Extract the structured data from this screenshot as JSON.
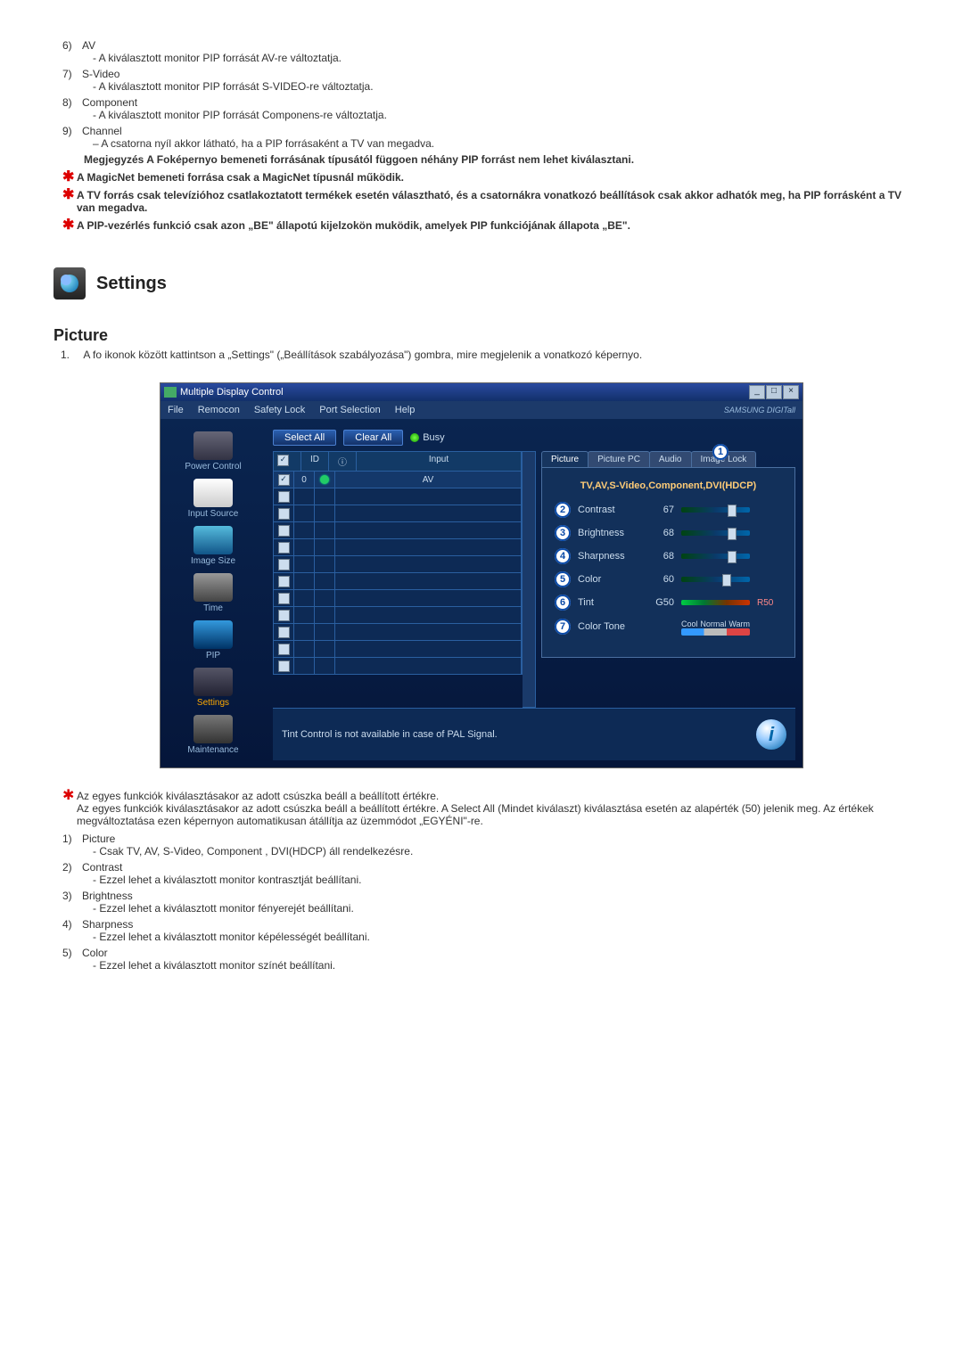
{
  "top_list": [
    {
      "num": "6)",
      "label": "AV",
      "desc": "- A kiválasztott monitor PIP forrását AV-re változtatja."
    },
    {
      "num": "7)",
      "label": "S-Video",
      "desc": "- A kiválasztott monitor PIP forrását S-VIDEO-re változtatja."
    },
    {
      "num": "8)",
      "label": "Component",
      "desc": "- A kiválasztott monitor PIP forrását Componens-re változtatja."
    },
    {
      "num": "9)",
      "label": "Channel",
      "desc": "– A csatorna nyíl akkor látható, ha a PIP forrásaként a TV van megadva."
    }
  ],
  "note_after9": "Megjegyzés A Foképernyo bemeneti forrásának típusától függoen néhány PIP forrást nem lehet kiválasztani.",
  "star_notes_top": [
    "A MagicNet bemeneti forrása csak a MagicNet típusnál működik.",
    "A TV forrás csak televízióhoz csatlakoztatott termékek esetén választható, és a csatornákra vonatkozó beállítások csak akkor adhatók meg, ha PIP forrásként a TV van megadva.",
    "A PIP-vezérlés funkció csak azon „BE\" állapotú kijelzokön muködik, amelyek PIP funkciójának állapota „BE\"."
  ],
  "settings_heading": "Settings",
  "picture_heading": "Picture",
  "picture_intro_num": "1.",
  "picture_intro": "A fo ikonok között kattintson a „Settings\" („Beállítások szabályozása\") gombra, mire megjelenik a vonatkozó képernyo.",
  "window": {
    "title": "Multiple Display Control",
    "menu": [
      "File",
      "Remocon",
      "Safety Lock",
      "Port Selection",
      "Help"
    ],
    "brand": "SAMSUNG DIGITall",
    "buttons": {
      "select_all": "Select All",
      "clear_all": "Clear All",
      "busy": "Busy"
    },
    "sidebar": [
      {
        "label": "Power Control"
      },
      {
        "label": "Input Source"
      },
      {
        "label": "Image Size"
      },
      {
        "label": "Time"
      },
      {
        "label": "PIP"
      },
      {
        "label": "Settings",
        "selected": true
      },
      {
        "label": "Maintenance"
      }
    ],
    "grid": {
      "headers": {
        "chk": "✓",
        "id": "ID",
        "info": "ⓘ",
        "input": "Input"
      },
      "row0": {
        "id": "0",
        "input": "AV"
      },
      "blank_rows": 11
    },
    "tabs": [
      "Picture",
      "Picture PC",
      "Audio",
      "Image Lock"
    ],
    "panel_head": "TV,AV,S-Video,Component,DVI(HDCP)",
    "sliders": [
      {
        "n": "2",
        "label": "Contrast",
        "val": "67",
        "pos": 67
      },
      {
        "n": "3",
        "label": "Brightness",
        "val": "68",
        "pos": 68
      },
      {
        "n": "4",
        "label": "Sharpness",
        "val": "68",
        "pos": 68
      },
      {
        "n": "5",
        "label": "Color",
        "val": "60",
        "pos": 60
      }
    ],
    "tint": {
      "n": "6",
      "label": "Tint",
      "val": "G50",
      "rval": "R50",
      "pos": 50
    },
    "ctone": {
      "n": "7",
      "label": "Color Tone",
      "labels": [
        "Cool",
        "Normal",
        "Warm"
      ],
      "pos": 50
    },
    "footer": "Tint Control is not available in case of PAL Signal."
  },
  "star_note_mid_head": "Az egyes funkciók kiválasztásakor az adott csúszka beáll a beállított értékre.",
  "star_note_mid_body": "Az egyes funkciók kiválasztásakor az adott csúszka beáll a beállított értékre. A Select All (Mindet kiválaszt) kiválasztása esetén az alapérték (50) jelenik meg. Az értékek megváltoztatása ezen képernyon automatikusan átállítja az üzemmódot „EGYÉNI\"-re.",
  "bottom_list": [
    {
      "num": "1)",
      "label": "Picture",
      "desc": "- Csak TV, AV, S-Video, Component , DVI(HDCP) áll rendelkezésre."
    },
    {
      "num": "2)",
      "label": "Contrast",
      "desc": "- Ezzel lehet a kiválasztott monitor kontrasztját beállítani."
    },
    {
      "num": "3)",
      "label": "Brightness",
      "desc": "- Ezzel lehet a kiválasztott monitor fényerejét beállítani."
    },
    {
      "num": "4)",
      "label": "Sharpness",
      "desc": "- Ezzel lehet a kiválasztott monitor képélességét beállítani."
    },
    {
      "num": "5)",
      "label": "Color",
      "desc": "- Ezzel lehet a kiválasztott monitor színét beállítani."
    }
  ]
}
